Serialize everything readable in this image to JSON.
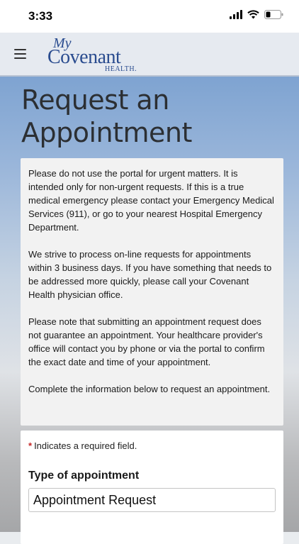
{
  "status_bar": {
    "time": "3:33"
  },
  "header": {
    "logo": {
      "line1": "My",
      "line2": "Covenant",
      "line3": "HEALTH."
    }
  },
  "page": {
    "title_line1": "Request an",
    "title_line2": "Appointment"
  },
  "info": {
    "paragraphs": [
      "Please do not use the portal for urgent matters. It is intended only for non-urgent requests. If this is a true medical emergency please contact your Emergency Medical Services (911), or go to your nearest Hospital Emergency Department.",
      "We strive to process on-line requests for appointments within 3 business days. If you have something that needs to be addressed more quickly, please call your Covenant Health physician office.",
      "Please note that submitting an appointment request does not guarantee an appointment. Your healthcare provider's office will contact you by phone or via the portal to confirm the exact date and time of your appointment.",
      "Complete the information below to request an appointment."
    ]
  },
  "form": {
    "required_star": "*",
    "required_note": "Indicates a required field.",
    "type_label": "Type of appointment",
    "type_value": "Appointment Request"
  },
  "colors": {
    "brand": "#2a4c8f",
    "required": "#c62828"
  }
}
